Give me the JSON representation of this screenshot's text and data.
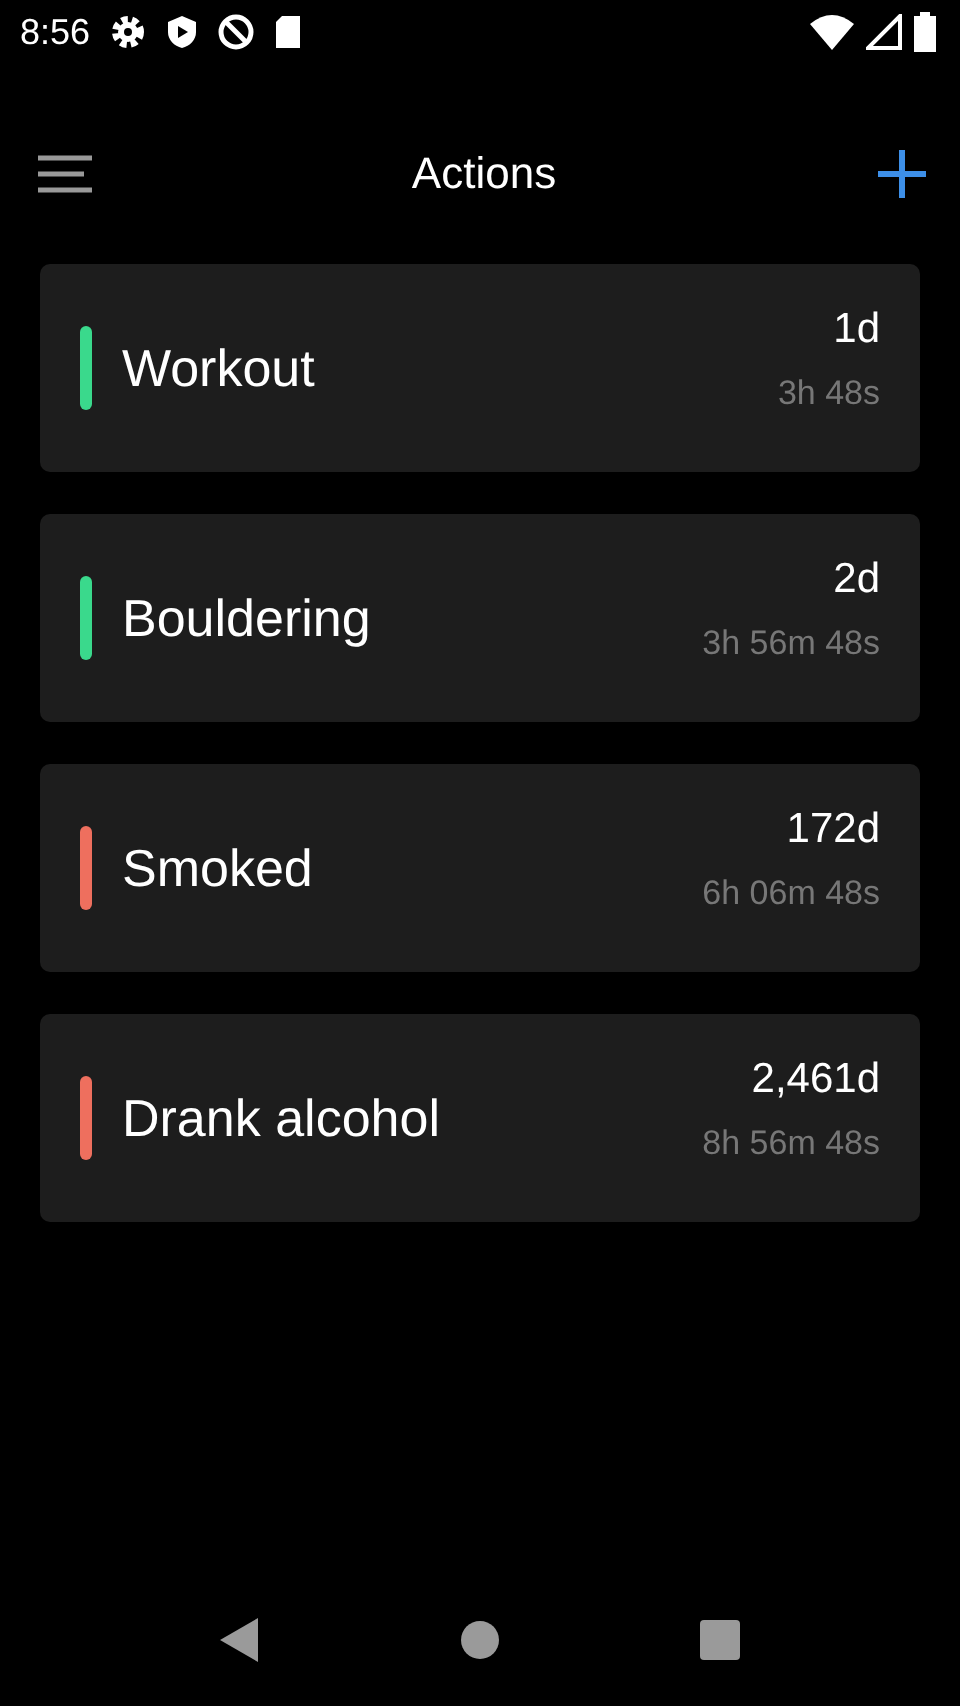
{
  "status_bar": {
    "time": "8:56"
  },
  "header": {
    "title": "Actions"
  },
  "actions": [
    {
      "name": "Workout",
      "days": "1d",
      "elapsed": "3h 48s",
      "color": "#3ad98c"
    },
    {
      "name": "Bouldering",
      "days": "2d",
      "elapsed": "3h 56m 48s",
      "color": "#3ad98c"
    },
    {
      "name": "Smoked",
      "days": "172d",
      "elapsed": "6h 06m 48s",
      "color": "#ee6f5e"
    },
    {
      "name": "Drank alcohol",
      "days": "2,461d",
      "elapsed": "8h 56m 48s",
      "color": "#ee6f5e"
    }
  ]
}
